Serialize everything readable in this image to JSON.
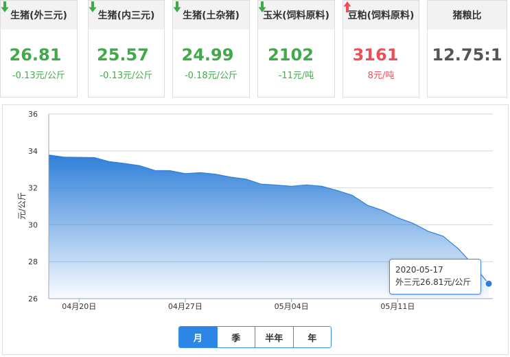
{
  "cards": [
    {
      "title": "生猪(外三元)",
      "price": "26.81",
      "change": "-0.13元/公斤",
      "trend": "down",
      "arrow_icon": "arrow-down-icon"
    },
    {
      "title": "生猪(内三元)",
      "price": "25.57",
      "change": "-0.13元/公斤",
      "trend": "down",
      "arrow_icon": "arrow-down-icon"
    },
    {
      "title": "生猪(土杂猪)",
      "price": "24.99",
      "change": "-0.18元/公斤",
      "trend": "down",
      "arrow_icon": "arrow-down-icon"
    },
    {
      "title": "玉米(饲料原料)",
      "price": "2102",
      "change": "-11元/吨",
      "trend": "down",
      "arrow_icon": "arrow-down-icon"
    },
    {
      "title": "豆粕(饲料原料)",
      "price": "3161",
      "change": "8元/吨",
      "trend": "up",
      "arrow_icon": "arrow-up-icon"
    },
    {
      "title": "猪粮比",
      "price": "12.75:1",
      "change": "",
      "trend": "neutral",
      "arrow_icon": ""
    }
  ],
  "colors": {
    "down": "#41a94a",
    "up": "#ec4f56",
    "series": "#2f7fd8"
  },
  "chart_data": {
    "type": "area",
    "ylabel": "元/公斤",
    "ylim": [
      26,
      36
    ],
    "yticks": [
      26,
      28,
      30,
      32,
      34,
      36
    ],
    "xtick_labels": [
      "04月20日",
      "04月27日",
      "05月04日",
      "05月11日"
    ],
    "xtick_dates": [
      "2020-04-20",
      "2020-04-27",
      "2020-05-04",
      "2020-05-11"
    ],
    "grid": true,
    "series": [
      {
        "x": [
          "2020-04-18",
          "2020-04-19",
          "2020-04-20",
          "2020-04-21",
          "2020-04-22",
          "2020-04-23",
          "2020-04-24",
          "2020-04-25",
          "2020-04-26",
          "2020-04-27",
          "2020-04-28",
          "2020-04-29",
          "2020-04-30",
          "2020-05-01",
          "2020-05-02",
          "2020-05-03",
          "2020-05-04",
          "2020-05-05",
          "2020-05-06",
          "2020-05-07",
          "2020-05-08",
          "2020-05-09",
          "2020-05-10",
          "2020-05-11",
          "2020-05-12",
          "2020-05-13",
          "2020-05-14",
          "2020-05-15",
          "2020-05-16",
          "2020-05-17"
        ],
        "values": [
          33.78,
          33.66,
          33.65,
          33.64,
          33.42,
          33.32,
          33.2,
          32.94,
          32.93,
          32.77,
          32.82,
          32.74,
          32.58,
          32.47,
          32.2,
          32.15,
          32.08,
          32.16,
          32.08,
          31.86,
          31.6,
          31.06,
          30.78,
          30.38,
          30.08,
          29.65,
          29.38,
          28.7,
          27.8,
          26.81
        ]
      }
    ]
  },
  "tooltip": {
    "date": "2020-05-17",
    "text": "外三元26.81元/公斤"
  },
  "periods": [
    {
      "label": "月",
      "active": true
    },
    {
      "label": "季",
      "active": false
    },
    {
      "label": "半年",
      "active": false
    },
    {
      "label": "年",
      "active": false
    }
  ]
}
